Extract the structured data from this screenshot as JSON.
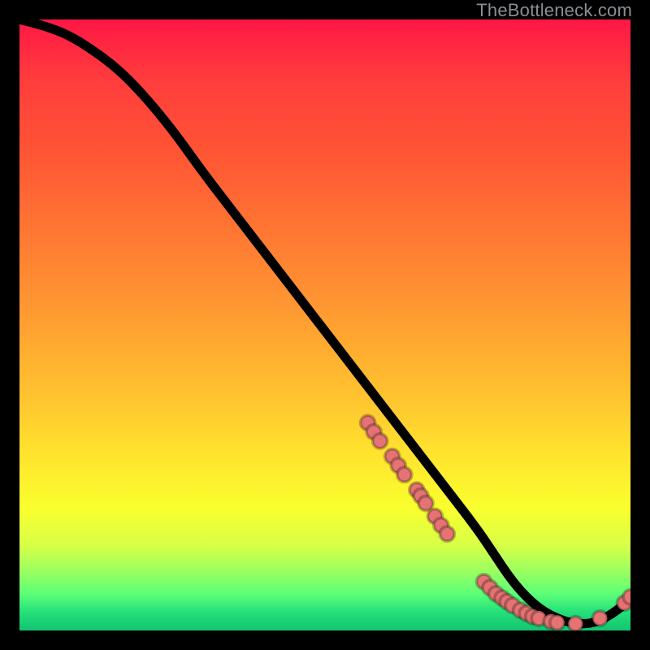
{
  "watermark": "TheBottleneck.com",
  "colors": {
    "background": "#000000",
    "curve": "#000000",
    "dot": "#e57373",
    "watermark": "#8a8f93"
  },
  "chart_data": {
    "type": "line",
    "title": "",
    "xlabel": "",
    "ylabel": "",
    "xlim": [
      0,
      100
    ],
    "ylim": [
      0,
      100
    ],
    "grid": false,
    "legend": false,
    "series": [
      {
        "name": "curve",
        "x": [
          0,
          4,
          8,
          12,
          16,
          20,
          25,
          30,
          35,
          40,
          45,
          50,
          55,
          60,
          65,
          70,
          75,
          78,
          80,
          82,
          84,
          86,
          88,
          90,
          93,
          96,
          100
        ],
        "y": [
          100,
          99,
          97.5,
          95,
          92,
          88,
          82,
          75,
          68.5,
          62,
          55.5,
          49,
          42.5,
          36,
          29.5,
          23,
          16.5,
          12,
          9,
          6.5,
          4.5,
          3,
          2,
          1.3,
          1,
          2,
          5
        ]
      }
    ],
    "points": [
      {
        "x": 57,
        "y": 34
      },
      {
        "x": 58,
        "y": 32.5
      },
      {
        "x": 59,
        "y": 31
      },
      {
        "x": 61,
        "y": 28.5
      },
      {
        "x": 62,
        "y": 27
      },
      {
        "x": 63,
        "y": 25.5
      },
      {
        "x": 65,
        "y": 23
      },
      {
        "x": 65.7,
        "y": 22
      },
      {
        "x": 66.5,
        "y": 20.8
      },
      {
        "x": 68,
        "y": 18.7
      },
      {
        "x": 69,
        "y": 17.2
      },
      {
        "x": 70,
        "y": 15.8
      },
      {
        "x": 76,
        "y": 8
      },
      {
        "x": 77,
        "y": 7
      },
      {
        "x": 78,
        "y": 6
      },
      {
        "x": 79,
        "y": 5.3
      },
      {
        "x": 79.8,
        "y": 4.7
      },
      {
        "x": 80.7,
        "y": 4.1
      },
      {
        "x": 82,
        "y": 3.3
      },
      {
        "x": 83,
        "y": 2.8
      },
      {
        "x": 84,
        "y": 2.3
      },
      {
        "x": 85,
        "y": 2
      },
      {
        "x": 87,
        "y": 1.5
      },
      {
        "x": 88,
        "y": 1.3
      },
      {
        "x": 91,
        "y": 1.1
      },
      {
        "x": 95,
        "y": 2
      },
      {
        "x": 99,
        "y": 4.5
      },
      {
        "x": 100,
        "y": 5.5
      }
    ]
  }
}
